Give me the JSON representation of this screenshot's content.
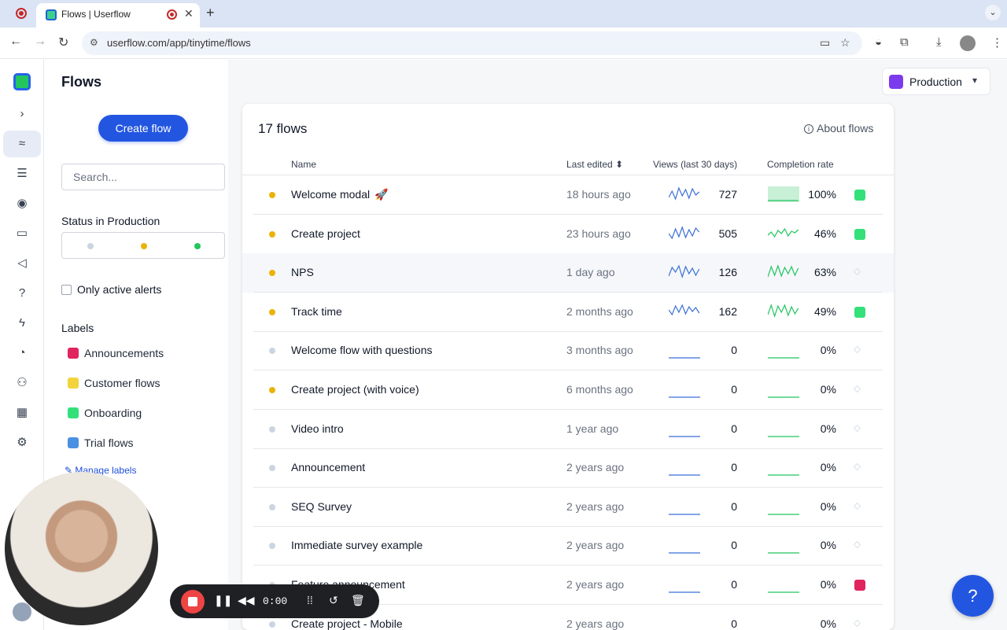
{
  "browser": {
    "tab_title": "Flows | Userflow",
    "url": "userflow.com/app/tinytime/flows"
  },
  "app": {
    "page_title": "Flows",
    "create_button": "Create flow",
    "search_placeholder": "Search...",
    "status_filter_label": "Status in Production",
    "alerts_label": "Only active alerts",
    "labels_title": "Labels",
    "labels": [
      {
        "name": "Announcements",
        "color": "#e0245e"
      },
      {
        "name": "Customer flows",
        "color": "#f2d43d"
      },
      {
        "name": "Onboarding",
        "color": "#34e07a"
      },
      {
        "name": "Trial flows",
        "color": "#4a90e2"
      }
    ],
    "manage_labels": "Manage labels",
    "environment": "Production"
  },
  "table": {
    "count": "17 flows",
    "about": "About flows",
    "columns": {
      "name": "Name",
      "last_edited": "Last edited",
      "views": "Views (last 30 days)",
      "completion": "Completion rate"
    },
    "rows": [
      {
        "name": "Welcome modal",
        "rocket": "🚀",
        "status": "#eab308",
        "edited": "18 hours ago",
        "views": "727",
        "rate": "100%",
        "label_color": "#34e07a",
        "active": true
      },
      {
        "name": "Create project",
        "status": "#eab308",
        "edited": "23 hours ago",
        "views": "505",
        "rate": "46%",
        "label_color": "#34e07a",
        "active": true
      },
      {
        "name": "NPS",
        "status": "#eab308",
        "edited": "1 day ago",
        "views": "126",
        "rate": "63%",
        "label_color": "",
        "active": true
      },
      {
        "name": "Track time",
        "status": "#eab308",
        "edited": "2 months ago",
        "views": "162",
        "rate": "49%",
        "label_color": "#34e07a",
        "active": true
      },
      {
        "name": "Welcome flow with questions",
        "status": "#cbd5e1",
        "edited": "3 months ago",
        "views": "0",
        "rate": "0%",
        "label_color": "",
        "active": false
      },
      {
        "name": "Create project (with voice)",
        "status": "#eab308",
        "edited": "6 months ago",
        "views": "0",
        "rate": "0%",
        "label_color": "",
        "active": false
      },
      {
        "name": "Video intro",
        "status": "#cbd5e1",
        "edited": "1 year ago",
        "views": "0",
        "rate": "0%",
        "label_color": "",
        "active": false
      },
      {
        "name": "Announcement",
        "status": "#cbd5e1",
        "edited": "2 years ago",
        "views": "0",
        "rate": "0%",
        "label_color": "",
        "active": false
      },
      {
        "name": "SEQ Survey",
        "status": "#cbd5e1",
        "edited": "2 years ago",
        "views": "0",
        "rate": "0%",
        "label_color": "",
        "active": false
      },
      {
        "name": "Immediate survey example",
        "status": "#cbd5e1",
        "edited": "2 years ago",
        "views": "0",
        "rate": "0%",
        "label_color": "",
        "active": false
      },
      {
        "name": "Feature announcement",
        "status": "#cbd5e1",
        "edited": "2 years ago",
        "views": "0",
        "rate": "0%",
        "label_color": "#e0245e",
        "active": false
      },
      {
        "name": "Create project - Mobile",
        "status": "#cbd5e1",
        "edited": "2 years ago",
        "views": "0",
        "rate": "0%",
        "label_color": "",
        "active": false
      }
    ]
  },
  "recorder": {
    "time": "0:00"
  },
  "colors": {
    "accent": "#2356e0",
    "status_yellow": "#eab308",
    "status_grey": "#cbd5e1",
    "status_green": "#22c55e"
  }
}
